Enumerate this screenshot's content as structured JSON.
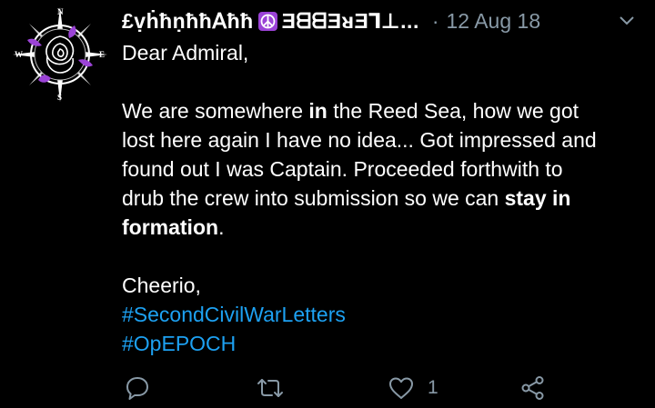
{
  "author": {
    "display_name": "£ṿḣħṇħħ𝖠ħħ",
    "emoji": "☮",
    "handle": "ƎᗺᗺƎᴚƎ⅂⊥...",
    "separator": "·",
    "date": "12 Aug 18"
  },
  "icons": {
    "avatar": "compass-rose-avatar",
    "menu": "chevron-down-icon",
    "reply": "reply-icon",
    "retweet": "retweet-icon",
    "like": "heart-icon",
    "share": "share-icon"
  },
  "tweet": {
    "greeting": "Dear Admiral,",
    "p1": {
      "l1_a": "We are somewhere ",
      "l1_b": "in",
      "l1_c": " the Reed Sea, how we got",
      "l2": "lost here again I have no idea... Got impressed and",
      "l3": "found out I was Captain. Proceeded forthwith to",
      "l4_a": "drub the crew into submission so we can ",
      "l4_b": "stay in",
      "l5_a": "formation",
      "l5_b": "."
    },
    "signoff": "Cheerio,",
    "hashtags": [
      "#SecondCivilWarLetters",
      "#OpEPOCH"
    ]
  },
  "actions": {
    "like_count": "1"
  },
  "colors": {
    "background": "#000000",
    "text": "#ffffff",
    "muted": "#8899a6",
    "link": "#1da1f2",
    "peace_badge": "#9b43d6"
  }
}
